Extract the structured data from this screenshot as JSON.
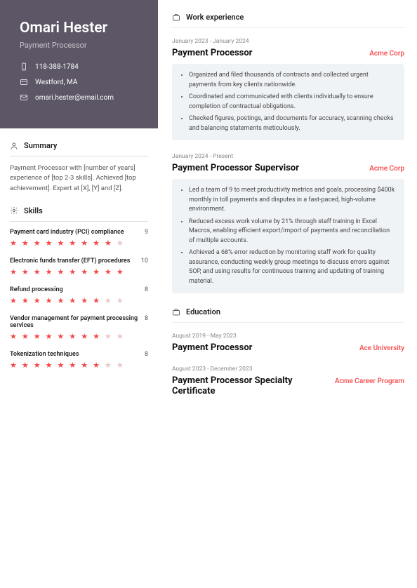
{
  "header": {
    "name": "Omari Hester",
    "title": "Payment Processor",
    "phone": "118-388-1784",
    "location": "Westford, MA",
    "email": "omari.hester@email.com"
  },
  "summary": {
    "heading": "Summary",
    "text": "Payment Processor with [number of years] experience of [top 2-3 skills]. Achieved [top achievement]. Expert at [X], [Y] and [Z]."
  },
  "skills": {
    "heading": "Skills",
    "items": [
      {
        "name": "Payment card industry (PCI) compliance",
        "rating": 9
      },
      {
        "name": "Electronic funds transfer (EFT) procedures",
        "rating": 10
      },
      {
        "name": "Refund processing",
        "rating": 8
      },
      {
        "name": "Vendor management for payment processing services",
        "rating": 8
      },
      {
        "name": "Tokenization techniques",
        "rating": 8
      }
    ]
  },
  "work": {
    "heading": "Work experience",
    "entries": [
      {
        "dates": "January 2023 - January 2024",
        "title": "Payment Processor",
        "org": "Acme Corp",
        "bullets": [
          "Organized and filed thousands of contracts and collected urgent payments from key clients nationwide.",
          "Coordinated and communicated with clients individually to ensure completion of contractual obligations.",
          "Checked figures, postings, and documents for accuracy, scanning checks and balancing statements meticulously."
        ]
      },
      {
        "dates": "January 2024 - Present",
        "title": "Payment Processor Supervisor",
        "org": "Acme Corp",
        "bullets": [
          "Led a team of 9 to meet productivity metrics and goals, processing $400k monthly in toll payments and disputes in a fast-paced, high-volume environment.",
          "Reduced excess work volume by 21% through staff training in Excel Macros, enabling efficient export/import of payments and reconciliation of multiple accounts.",
          "Achieved a 68% error reduction by monitoring staff work for quality assurance, conducting weekly group meetings to discuss errors against SOP, and using results for continuous training and updating of training material."
        ]
      }
    ]
  },
  "education": {
    "heading": "Education",
    "entries": [
      {
        "dates": "August 2019 - May 2023",
        "title": "Payment Processor",
        "org": "Ace University"
      },
      {
        "dates": "August 2023 - December 2023",
        "title": "Payment Processor Specialty Certificate",
        "org": "Acme Career Program"
      }
    ]
  }
}
